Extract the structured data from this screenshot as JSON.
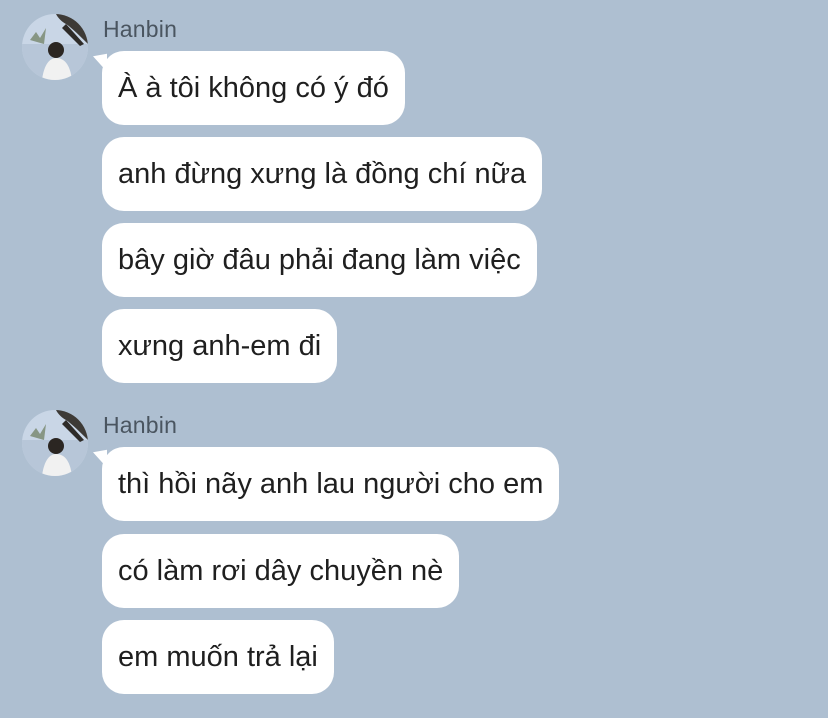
{
  "theme": {
    "background": "#aebfd1",
    "bubble": "#ffffff",
    "text": "#1f1f1f",
    "sender_text": "#4a5560"
  },
  "groups": [
    {
      "sender": "Hanbin",
      "avatar_icon": "profile-photo-avatar",
      "messages": [
        "À à tôi không có ý đó",
        "anh đừng xưng là đồng chí nữa",
        "bây giờ đâu phải đang làm việc",
        "xưng anh-em đi"
      ]
    },
    {
      "sender": "Hanbin",
      "avatar_icon": "profile-photo-avatar",
      "messages": [
        "thì hồi nãy anh lau người cho em",
        "có làm rơi dây chuyền nè",
        "em muốn trả lại"
      ]
    }
  ]
}
